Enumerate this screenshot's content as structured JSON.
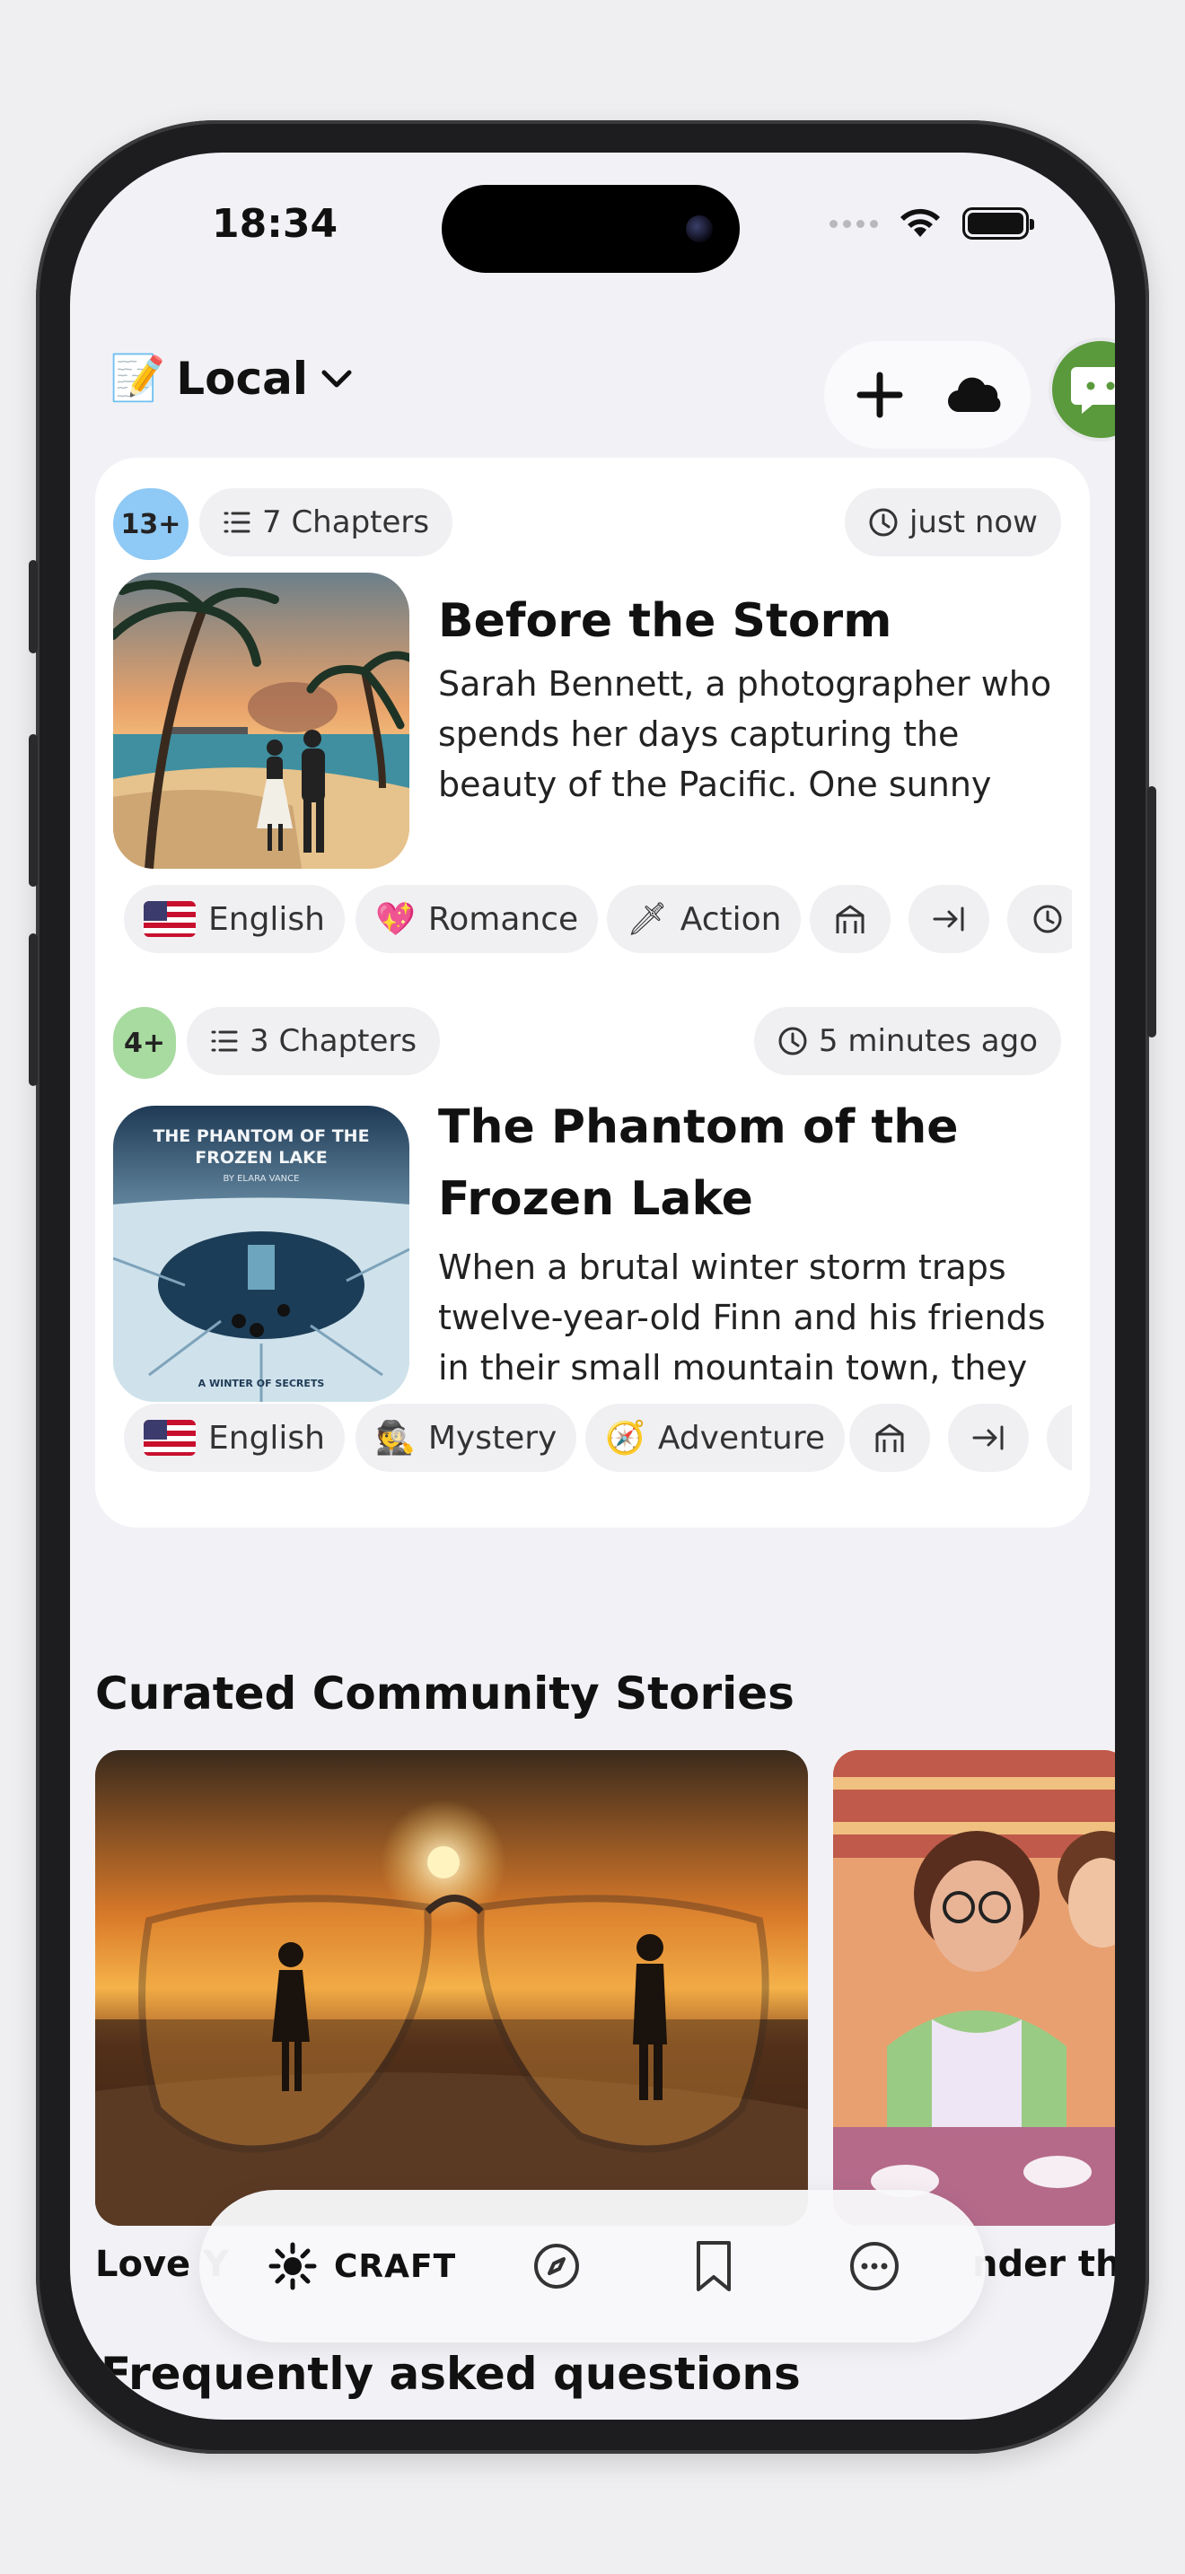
{
  "status": {
    "time": "18:34"
  },
  "header": {
    "title": "Local",
    "emoji": "📝"
  },
  "stories": [
    {
      "age": "13+",
      "age_color": "#8fc9f5",
      "chapters": "7 Chapters",
      "time": "just now",
      "title": "Before the Storm",
      "description": "Sarah Bennett, a photographer who spends her days capturing the beauty of the Pacific. One sunny afternoon,...",
      "tags": {
        "language": "English",
        "genre1": "Romance",
        "genre1_icon": "💖",
        "genre2": "Action",
        "genre2_icon": "🗡"
      }
    },
    {
      "age": "4+",
      "age_color": "#a8dba0",
      "chapters": "3 Chapters",
      "time": "5 minutes ago",
      "title": "The Phantom of the Frozen Lake",
      "description": "When a brutal winter storm traps twelve-year-old Finn and his friends in their small mountain town, they s...",
      "cover_title": "THE PHANTOM OF THE FROZEN LAKE",
      "cover_author": "BY ELARA VANCE",
      "cover_footer": "A WINTER OF SECRETS",
      "tags": {
        "language": "English",
        "genre1": "Mystery",
        "genre1_icon": "🕵",
        "genre2": "Adventure",
        "genre2_icon": "🧭"
      }
    }
  ],
  "curated": {
    "title": "Curated Community Stories",
    "items": [
      {
        "label": "Love Y"
      },
      {
        "label": "nder th"
      }
    ]
  },
  "faq": {
    "title": "Frequently asked questions"
  },
  "tabbar": {
    "craft_label": "CRAFT"
  }
}
